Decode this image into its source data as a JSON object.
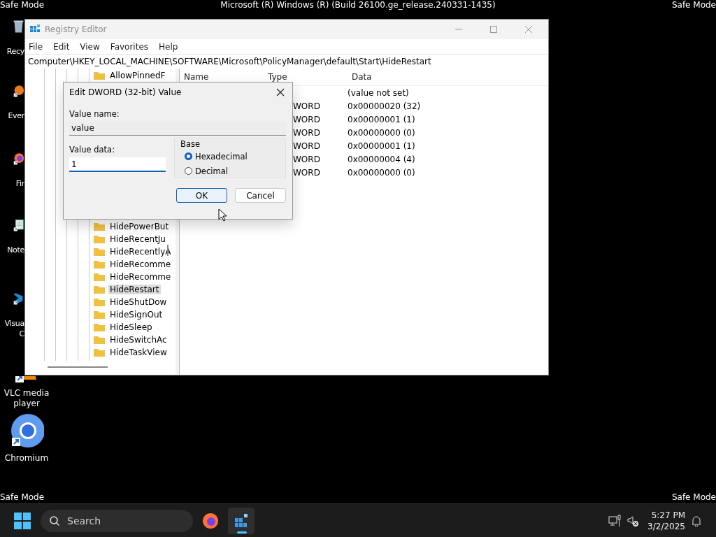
{
  "top_bar": {
    "left_label": "Safe Mode",
    "title": "Microsoft (R) Windows (R) (Build 26100.ge_release.240331-1435)",
    "right_label": "Safe Mode"
  },
  "desktop_icons": [
    {
      "kind": "recycle",
      "label": "Recy"
    },
    {
      "kind": "evernote",
      "label": "Ever"
    },
    {
      "kind": "firefox",
      "label": "Fir"
    },
    {
      "kind": "notepad",
      "label": "Note"
    },
    {
      "kind": "vscode",
      "label": "Visua C"
    },
    {
      "kind": "vlc",
      "label": "VLC media player"
    },
    {
      "kind": "chromium",
      "label": "Chromium"
    }
  ],
  "bottom_labels": {
    "left": "Safe Mode",
    "right": "Safe Mode"
  },
  "registry_window": {
    "title": "Registry Editor",
    "menu": [
      "File",
      "Edit",
      "View",
      "Favorites",
      "Help"
    ],
    "address": "Computer\\HKEY_LOCAL_MACHINE\\SOFTWARE\\Microsoft\\PolicyManager\\default\\Start\\HideRestart",
    "tree_top": [
      {
        "label": "AllowPinnedF",
        "selected": false
      }
    ],
    "tree_bottom": [
      {
        "label": "HidePowerBut",
        "selected": false
      },
      {
        "label": "HideRecentJu",
        "selected": false
      },
      {
        "label": "HideRecentlyA",
        "selected": false
      },
      {
        "label": "HideRecomme",
        "selected": false
      },
      {
        "label": "HideRecomme",
        "selected": false
      },
      {
        "label": "HideRestart",
        "selected": true
      },
      {
        "label": "HideShutDow",
        "selected": false
      },
      {
        "label": "HideSignOut",
        "selected": false
      },
      {
        "label": "HideSleep",
        "selected": false
      },
      {
        "label": "HideSwitchAc",
        "selected": false
      },
      {
        "label": "HideTaskView",
        "selected": false
      }
    ],
    "columns": [
      "Name",
      "Type",
      "Data"
    ],
    "rows": [
      {
        "data": "(value not set)"
      },
      {
        "type": "WORD",
        "data": "0x00000020 (32)"
      },
      {
        "type": "WORD",
        "data": "0x00000001 (1)"
      },
      {
        "type": "WORD",
        "data": "0x00000000 (0)"
      },
      {
        "type": "WORD",
        "data": "0x00000001 (1)"
      },
      {
        "type": "WORD",
        "data": "0x00000004 (4)"
      },
      {
        "type": "WORD",
        "data": "0x00000000 (0)"
      }
    ]
  },
  "dialog": {
    "title": "Edit DWORD (32-bit) Value",
    "value_name_label": "Value name:",
    "value_name": "value",
    "value_data_label": "Value data:",
    "value_data": "1",
    "base_label": "Base",
    "radios": [
      {
        "label": "Hexadecimal",
        "selected": true
      },
      {
        "label": "Decimal",
        "selected": false
      }
    ],
    "buttons": [
      {
        "label": "OK",
        "default": true
      },
      {
        "label": "Cancel",
        "default": false
      }
    ]
  },
  "taskbar": {
    "search_placeholder": "Search",
    "apps": [
      {
        "kind": "firefox",
        "active": false
      },
      {
        "kind": "regedit",
        "active": true
      }
    ],
    "time": "5:27 PM",
    "date": "3/2/2025"
  }
}
